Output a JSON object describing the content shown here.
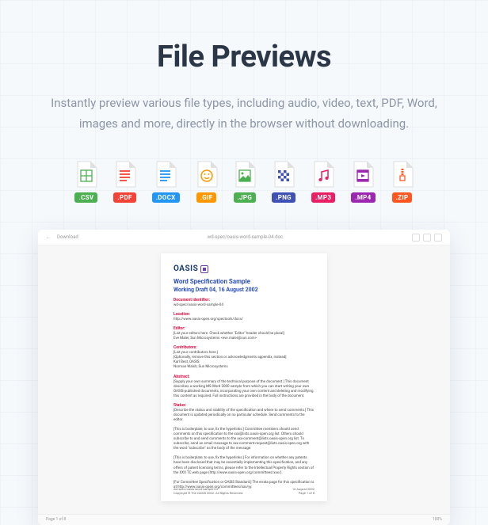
{
  "title": "File Previews",
  "description": "Instantly preview various file types, including audio, video, text, PDF, Word, images and more, directly in the browser without downloading.",
  "filetypes": [
    {
      "ext": ".CSV",
      "cls": "c-csv",
      "icon": "grid-icon",
      "tint": "#4caf50"
    },
    {
      "ext": ".PDF",
      "cls": "c-pdf",
      "icon": "lines-icon",
      "tint": "#f44336"
    },
    {
      "ext": ".DOCX",
      "cls": "c-docx",
      "icon": "lines-icon",
      "tint": "#2196f3"
    },
    {
      "ext": ".GIF",
      "cls": "c-gif",
      "icon": "smile-icon",
      "tint": "#ff9800"
    },
    {
      "ext": ".JPG",
      "cls": "c-jpg",
      "icon": "image-icon",
      "tint": "#4caf50"
    },
    {
      "ext": ".PNG",
      "cls": "c-png",
      "icon": "checker-icon",
      "tint": "#3f51b5"
    },
    {
      "ext": ".MP3",
      "cls": "c-mp3",
      "icon": "music-icon",
      "tint": "#e91e63"
    },
    {
      "ext": ".MP4",
      "cls": "c-mp4",
      "icon": "film-icon",
      "tint": "#9c27b0"
    },
    {
      "ext": ".ZIP",
      "cls": "c-zip",
      "icon": "zip-icon",
      "tint": "#ff5722"
    }
  ],
  "toolbar": {
    "download": "Download",
    "back": "←",
    "filepath": "wd-spec/oasis-word-sample-04.doc"
  },
  "doc": {
    "logo": "OASIS",
    "title": "Word Specification Sample",
    "subtitle": "Working Draft 04, 16 August 2002",
    "sections": [
      {
        "label": "Document identifier:",
        "body": "wd-spec/oasis-word-sample-04"
      },
      {
        "label": "Location:",
        "body": "http://www.oasis-open.org/spectools/docs/"
      },
      {
        "label": "Editor:",
        "body": "[List your editors here. Check whether \"Editor\" header should be plural]\nEve Maler, Sun Microsystems  <eve.maler@sun.com>"
      },
      {
        "label": "Contributors:",
        "body": "[List your contributors here.]\n[Optionally, remove this section or acknowledgments appendix, instead]\nKarl Best, OASIS\nNorman Walsh, Sun Microsystems"
      },
      {
        "label": "Abstract:",
        "body": "[Supply your own summary of the technical purpose of the document.] This document describes a working MS Word 2000 sample from which you can start writing your own OASIS-published documents, incorporating your own content and deleting and modifying this content as required. Full instructions are provided in the body of the document."
      },
      {
        "label": "Status:",
        "body": "[Describe the status and stability of the specification and where to send comments.] This document is updated periodically on no particular schedule. Send comments to the editor.\n\n[This is boilerplate; to use, fix the hyperlinks:] Committee members should send comments on this specification to the xxx@lists.oasis-open.org list. Others should subscribe to and send comments to the xxx-comment@lists.oasis-open.org list. To subscribe, send an email message to xxx-comment-request@lists.oasis-open.org with the word \"subscribe\" as the body of the message.\n\n[This is boilerplate; to use, fix the hyperlinks:] For information on whether any patents have been disclosed that may be essentially implementing this specification, and any offers of patent licensing terms, please refer to the Intellectual Property Rights section of the XXX TC web page (http://www.oasis-open.org/committees/xxx/).\n\n[For Committee Specification or OASIS Standard:] The errata page for this specification is at http://www.oasis-open.org/committees/xxx/yy."
      }
    ],
    "footer_left": "wd-spec/oasis-word-sample-04\nCopyright © The OASIS 2002. All Rights Reserved.",
    "footer_right": "16 August 2002\nPage 1 of 8"
  },
  "statusbar": {
    "left": "Page 1 of 8",
    "right": "100%"
  }
}
